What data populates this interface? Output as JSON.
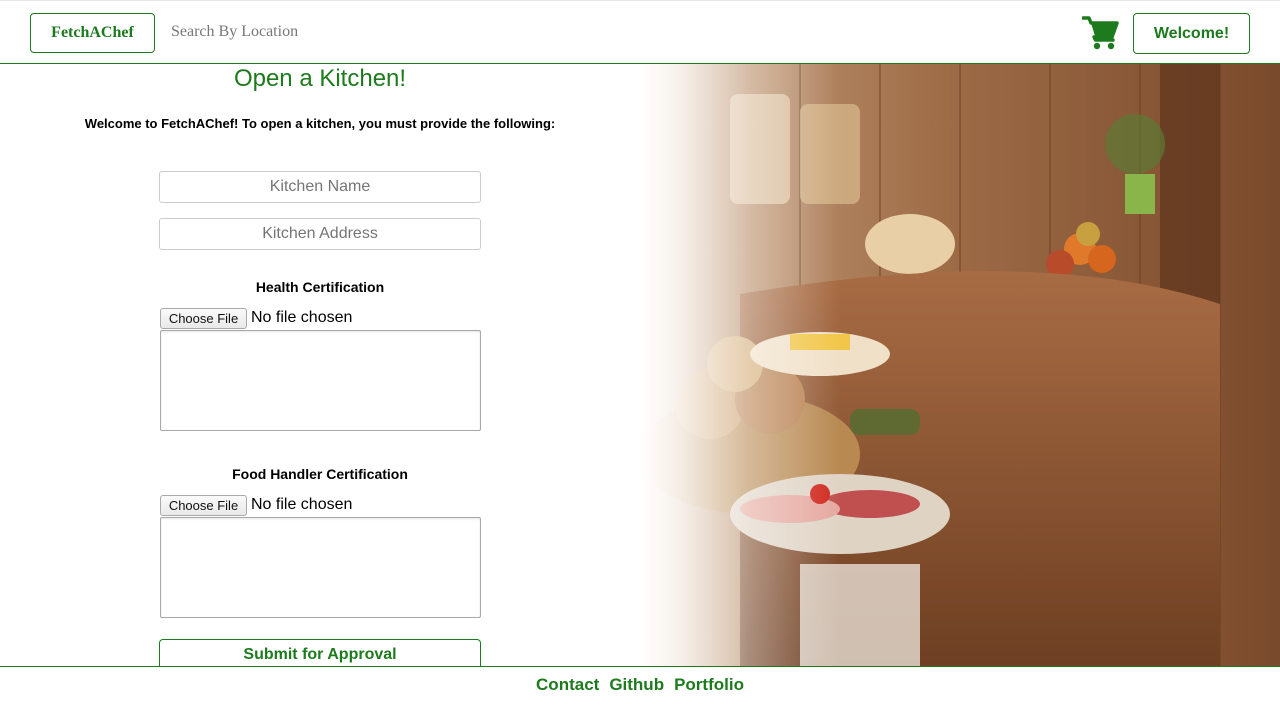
{
  "header": {
    "brand_label": "FetchAChef",
    "search_placeholder": "Search By Location",
    "cart_icon": "shopping-cart-icon",
    "welcome_label": "Welcome!"
  },
  "form": {
    "title": "Open a Kitchen!",
    "intro": "Welcome to FetchAChef! To open a kitchen, you must provide the following:",
    "kitchen_name_placeholder": "Kitchen Name",
    "kitchen_address_placeholder": "Kitchen Address",
    "health_cert_label": "Health Certification",
    "food_handler_label": "Food Handler Certification",
    "choose_file_label": "Choose File",
    "no_file_text": "No file chosen",
    "submit_label": "Submit for Approval"
  },
  "footer": {
    "links": [
      "Contact",
      "Github",
      "Portfolio"
    ]
  },
  "colors": {
    "accent": "#1d7a1d"
  }
}
